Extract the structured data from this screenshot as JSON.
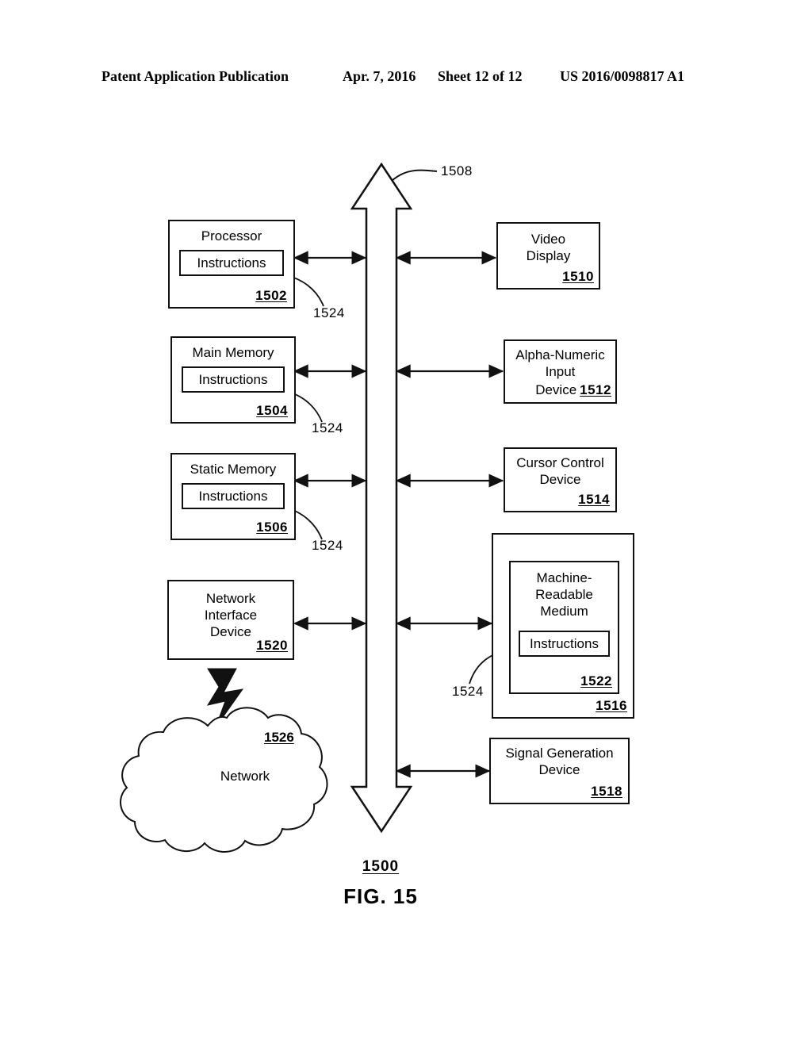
{
  "header": {
    "publication": "Patent Application Publication",
    "date": "Apr. 7, 2016",
    "sheet": "Sheet 12 of 12",
    "number": "US 2016/0098817 A1"
  },
  "figure": {
    "caption": "FIG. 15",
    "system_ref": "1500",
    "bus_ref": "1508"
  },
  "left_column": [
    {
      "title": "Processor",
      "inner_label": "Instructions",
      "ref": "1502",
      "leader_ref": "1524"
    },
    {
      "title": "Main Memory",
      "inner_label": "Instructions",
      "ref": "1504",
      "leader_ref": "1524"
    },
    {
      "title": "Static Memory",
      "inner_label": "Instructions",
      "ref": "1506",
      "leader_ref": "1524"
    }
  ],
  "network_interface": {
    "title": "Network\nInterface\nDevice",
    "ref": "1520"
  },
  "network_cloud": {
    "label": "Network",
    "ref": "1526"
  },
  "right_column": {
    "video_display": {
      "title": "Video\nDisplay",
      "ref": "1510"
    },
    "alpha_numeric_input": {
      "title_lines": "Alpha-Numeric\nInput",
      "title_last": "Device",
      "ref": "1512"
    },
    "cursor_control": {
      "title": "Cursor Control\nDevice",
      "ref": "1514"
    },
    "drive_unit": {
      "ref": "1516",
      "medium": {
        "title": "Machine-\nReadable\nMedium",
        "inner_label": "Instructions",
        "ref": "1522",
        "leader_ref": "1524"
      }
    },
    "signal_generation": {
      "title": "Signal Generation\nDevice",
      "ref": "1518"
    }
  },
  "colors": {
    "ink": "#111111",
    "paper": "#ffffff"
  }
}
